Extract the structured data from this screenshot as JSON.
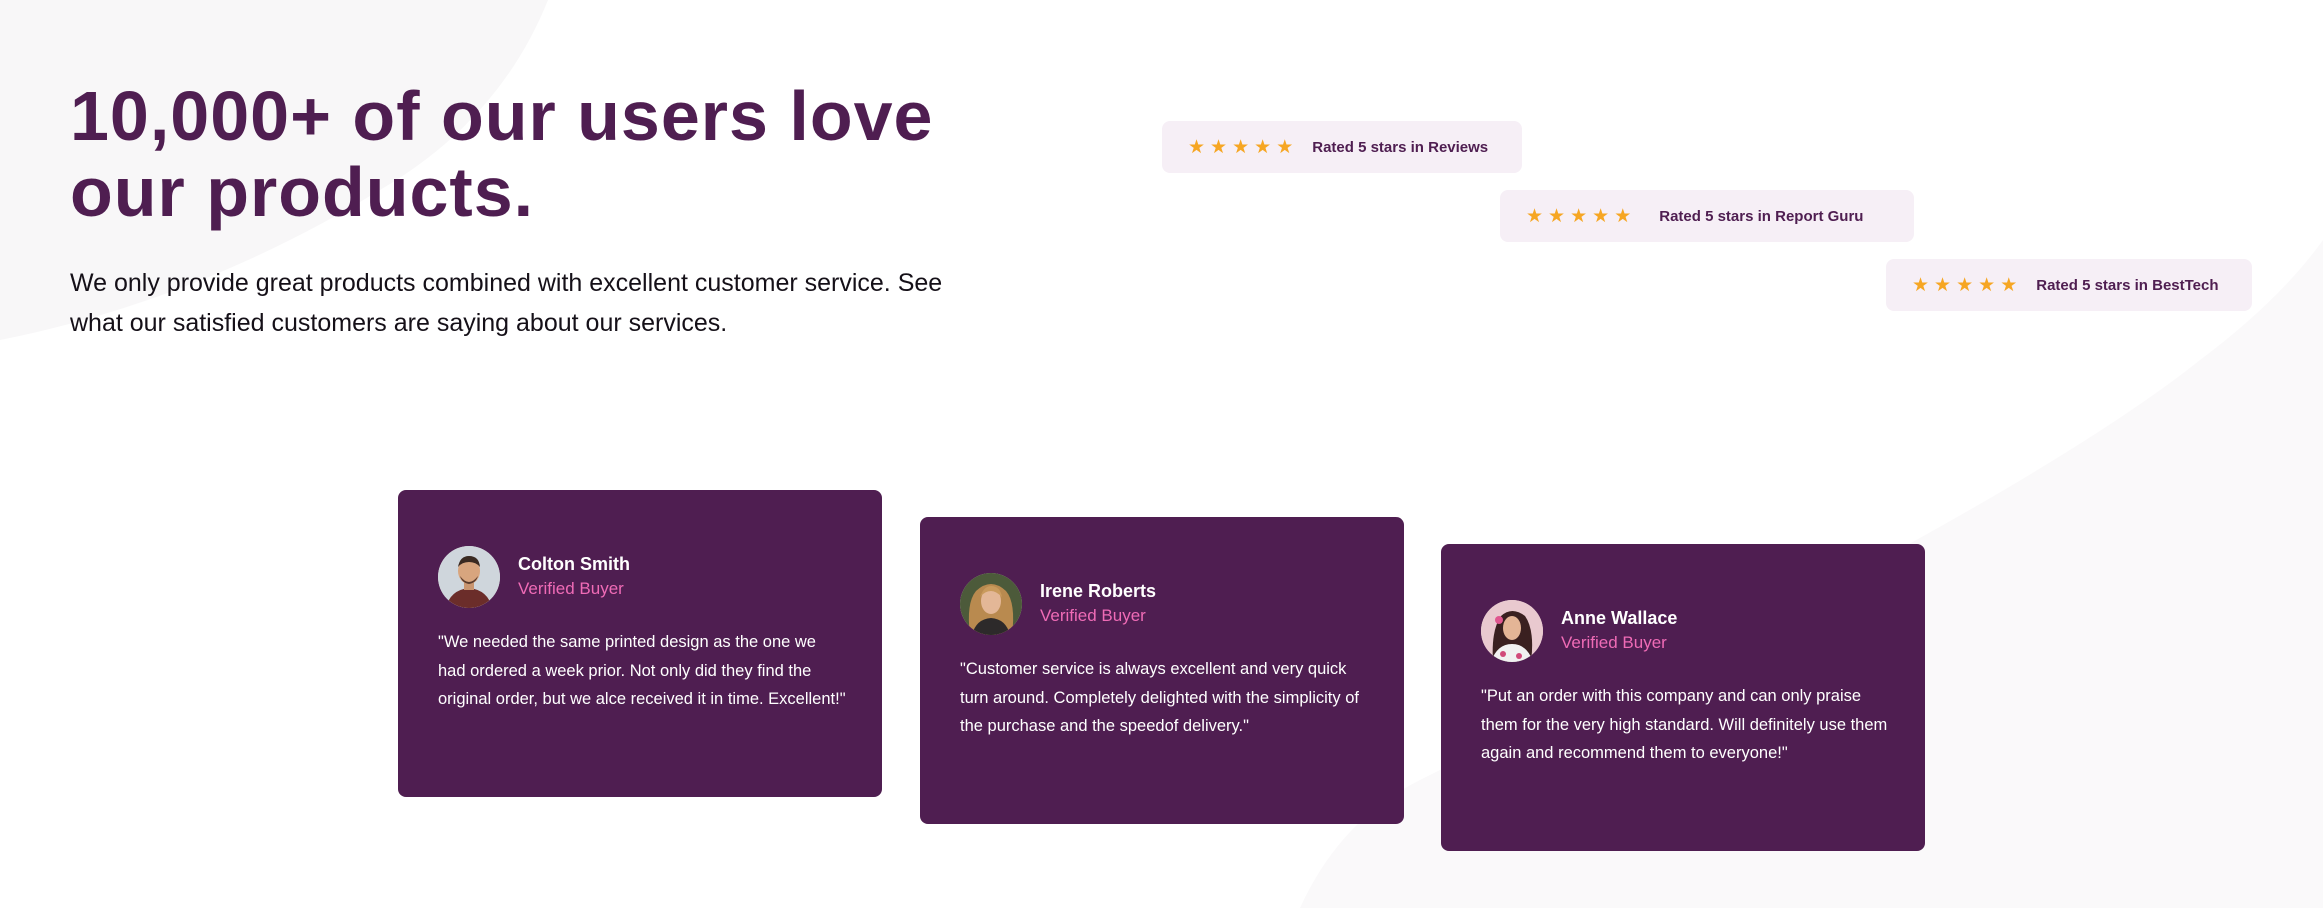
{
  "heading": "10,000+ of our users love our products.",
  "subtext": "We only provide great products combined with excellent customer service. See what our satisfied customers are saying about our services.",
  "ratings": [
    {
      "stars": 5,
      "label": "Rated 5 stars in Reviews"
    },
    {
      "stars": 5,
      "label": "Rated 5 stars in Report Guru"
    },
    {
      "stars": 5,
      "label": "Rated 5 stars in BestTech"
    }
  ],
  "testimonials": [
    {
      "name": "Colton Smith",
      "badge": "Verified Buyer",
      "quote": "\"We needed the same printed design as the one we had ordered a week prior. Not only did they find the original order, but we alce received it in time. Excellent!\""
    },
    {
      "name": "Irene Roberts",
      "badge": "Verified Buyer",
      "quote": "\"Customer service is always excellent and very quick turn around. Completely delighted with the simplicity of the purchase and the speedof delivery.\""
    },
    {
      "name": "Anne Wallace",
      "badge": "Verified Buyer",
      "quote": "\"Put an order with this company and can only praise them for the very high standard. Will definitely use them again and recommend them to everyone!\""
    }
  ],
  "colors": {
    "primary": "#4f1e51",
    "accent": "#ef6bb6",
    "star": "#f6a623",
    "badge_bg": "#f6eff6",
    "text": "#151018"
  },
  "icons": [
    "star-icon",
    "avatar-colton-smith",
    "avatar-irene-roberts",
    "avatar-anne-wallace"
  ]
}
